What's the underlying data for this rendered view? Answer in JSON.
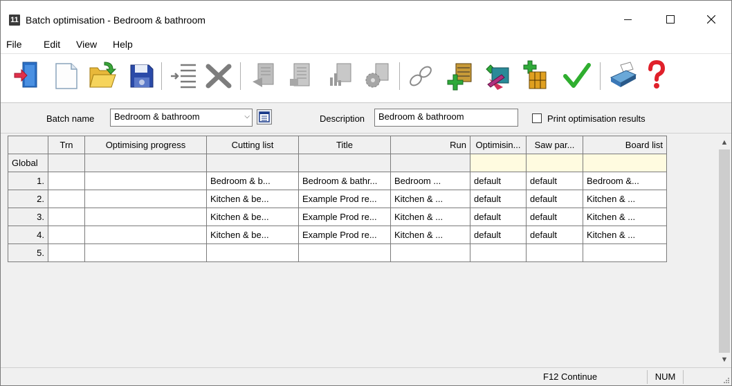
{
  "window": {
    "app_icon_text": "11",
    "title": "Batch optimisation - Bedroom & bathroom"
  },
  "menu": {
    "items": [
      "File",
      "Edit",
      "View",
      "Help"
    ]
  },
  "batch": {
    "name_label": "Batch name",
    "name_value": "Bedroom & bathroom",
    "description_label": "Description",
    "description_value": "Bedroom & bathroom",
    "print_label": "Print optimisation results",
    "print_checked": false
  },
  "grid": {
    "columns": [
      "",
      "Trn",
      "Optimising progress",
      "Cutting list",
      "Title",
      "Run",
      "Optimisin...",
      "Saw par...",
      "Board list"
    ],
    "global_label": "Global",
    "rows": [
      {
        "num": "1.",
        "trn": "",
        "progress": "",
        "cutting": "Bedroom & b...",
        "title": "Bedroom & bathr...",
        "run": "Bedroom ...",
        "opt": "default",
        "saw": "default",
        "board": "Bedroom &..."
      },
      {
        "num": "2.",
        "trn": "",
        "progress": "",
        "cutting": "Kitchen & be...",
        "title": "Example Prod re...",
        "run": "Kitchen & ...",
        "opt": "default",
        "saw": "default",
        "board": "Kitchen & ..."
      },
      {
        "num": "3.",
        "trn": "",
        "progress": "",
        "cutting": "Kitchen & be...",
        "title": "Example Prod re...",
        "run": "Kitchen & ...",
        "opt": "default",
        "saw": "default",
        "board": "Kitchen & ..."
      },
      {
        "num": "4.",
        "trn": "",
        "progress": "",
        "cutting": "Kitchen & be...",
        "title": "Example Prod re...",
        "run": "Kitchen & ...",
        "opt": "default",
        "saw": "default",
        "board": "Kitchen & ..."
      },
      {
        "num": "5.",
        "trn": "",
        "progress": "",
        "cutting": "",
        "title": "",
        "run": "",
        "opt": "",
        "saw": "",
        "board": ""
      }
    ]
  },
  "status": {
    "continue": "F12 Continue",
    "num": "NUM"
  },
  "colors": {
    "global_highlight": "#fffbe0",
    "check_green": "#2fae2f",
    "help_red": "#e0202a"
  }
}
